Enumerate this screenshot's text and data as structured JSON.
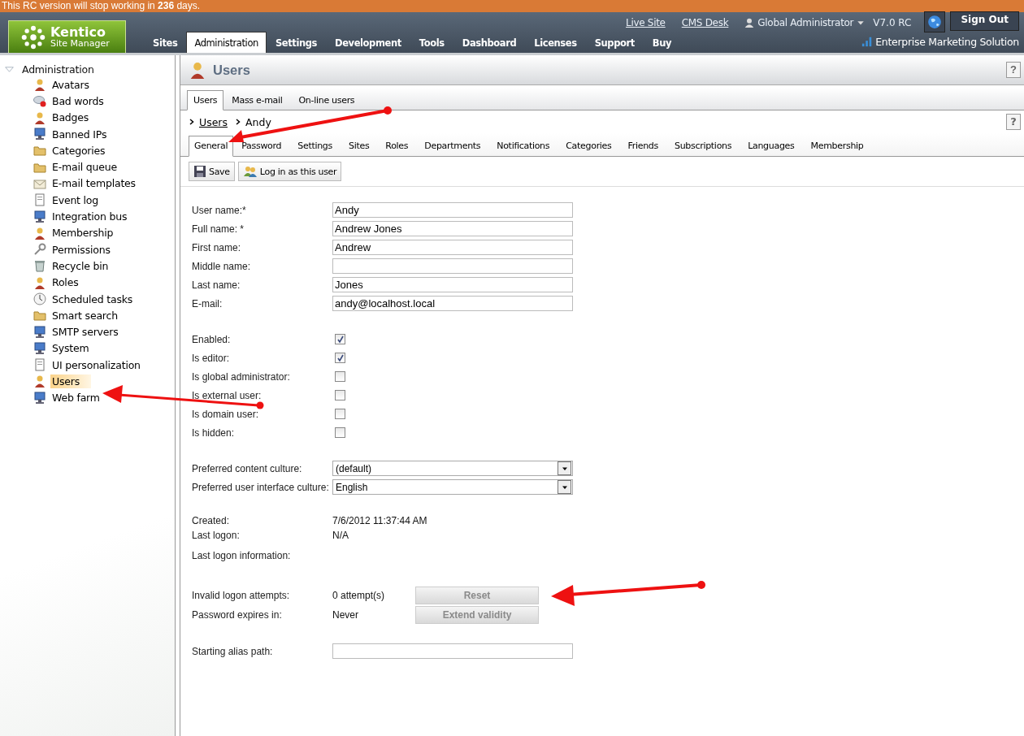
{
  "banner": {
    "text": "This RC version will stop working in **236** days."
  },
  "header": {
    "logo": {
      "title": "Kentico",
      "subtitle": "Site Manager"
    },
    "nav_tabs": [
      {
        "label": "Sites",
        "selected": false
      },
      {
        "label": "Administration",
        "selected": true
      },
      {
        "label": "Settings",
        "selected": false
      },
      {
        "label": "Development",
        "selected": false
      },
      {
        "label": "Tools",
        "selected": false
      },
      {
        "label": "Dashboard",
        "selected": false
      },
      {
        "label": "Licenses",
        "selected": false
      },
      {
        "label": "Support",
        "selected": false
      },
      {
        "label": "Buy",
        "selected": false
      }
    ],
    "links": [
      "Live Site",
      "CMS Desk"
    ],
    "user": "Global Administrator",
    "version": "V7.0 RC",
    "sign_out": "Sign Out",
    "edition": "Enterprise Marketing Solution"
  },
  "sidebar": {
    "root": {
      "label": "Administration",
      "expanded": true,
      "children": [
        {
          "label": "Avatars",
          "selected": false
        },
        {
          "label": "Bad words",
          "selected": false
        },
        {
          "label": "Badges",
          "selected": false
        },
        {
          "label": "Banned IPs",
          "selected": false
        },
        {
          "label": "Categories",
          "selected": false
        },
        {
          "label": "E-mail queue",
          "selected": false
        },
        {
          "label": "E-mail templates",
          "selected": false
        },
        {
          "label": "Event log",
          "selected": false
        },
        {
          "label": "Integration bus",
          "selected": false
        },
        {
          "label": "Membership",
          "selected": false
        },
        {
          "label": "Permissions",
          "selected": false
        },
        {
          "label": "Recycle bin",
          "selected": false
        },
        {
          "label": "Roles",
          "selected": false
        },
        {
          "label": "Scheduled tasks",
          "selected": false
        },
        {
          "label": "Smart search",
          "selected": false
        },
        {
          "label": "SMTP servers",
          "selected": false
        },
        {
          "label": "System",
          "selected": false
        },
        {
          "label": "UI personalization",
          "selected": false
        },
        {
          "label": "Users",
          "selected": true
        },
        {
          "label": "Web farm",
          "selected": false
        }
      ]
    }
  },
  "page": {
    "title": "Users",
    "title_help": "?",
    "breadcrumb_help": "?",
    "tabs": [
      {
        "label": "Users",
        "selected": true
      },
      {
        "label": "Mass e-mail",
        "selected": false
      },
      {
        "label": "On-line users",
        "selected": false
      }
    ],
    "breadcrumb": [
      {
        "label": "Users",
        "link": true
      },
      {
        "label": "Andy",
        "link": false
      }
    ],
    "user_tabs": [
      {
        "label": "General",
        "selected": true
      },
      {
        "label": "Password",
        "selected": false
      },
      {
        "label": "Settings",
        "selected": false
      },
      {
        "label": "Sites",
        "selected": false
      },
      {
        "label": "Roles",
        "selected": false
      },
      {
        "label": "Departments",
        "selected": false
      },
      {
        "label": "Notifications",
        "selected": false
      },
      {
        "label": "Categories",
        "selected": false
      },
      {
        "label": "Friends",
        "selected": false
      },
      {
        "label": "Subscriptions",
        "selected": false
      },
      {
        "label": "Languages",
        "selected": false
      },
      {
        "label": "Membership",
        "selected": false
      }
    ],
    "toolbar": [
      "Save",
      "Log in as this user"
    ],
    "form_groups": [
      [
        {
          "kind": "text",
          "label": "User name:*",
          "value": "Andy"
        },
        {
          "kind": "text",
          "label": "Full name: *",
          "value": "Andrew Jones"
        },
        {
          "kind": "text",
          "label": "First name:",
          "value": "Andrew"
        },
        {
          "kind": "text",
          "label": "Middle name:"
        },
        {
          "kind": "text",
          "label": "Last name:",
          "value": "Jones"
        },
        {
          "kind": "text",
          "label": "E-mail:",
          "value": "andy@localhost.local"
        }
      ],
      [
        {
          "kind": "checkbox",
          "label": "Enabled:",
          "checked": true
        },
        {
          "kind": "checkbox",
          "label": "Is editor:",
          "checked": true
        },
        {
          "kind": "checkbox",
          "label": "Is global administrator:",
          "checked": false
        },
        {
          "kind": "checkbox",
          "label": "Is external user:",
          "checked": false
        },
        {
          "kind": "checkbox",
          "label": "Is domain user:",
          "checked": false
        },
        {
          "kind": "checkbox",
          "label": "Is hidden:",
          "checked": false
        }
      ],
      [
        {
          "kind": "select",
          "label": "Preferred content culture:",
          "value": "(default)"
        },
        {
          "kind": "select",
          "label": "Preferred user interface culture:",
          "value": "English"
        }
      ],
      [
        {
          "kind": "info",
          "label": "Created:",
          "value": "7/6/2012 11:37:44 AM"
        },
        {
          "kind": "info",
          "label": "Last logon:",
          "value": "N/A"
        },
        {
          "kind": "info",
          "label": "Last logon information:"
        }
      ],
      [
        {
          "kind": "action",
          "label": "Invalid logon attempts:",
          "value": "0 attempt(s)",
          "button": "Reset",
          "disabled": true
        },
        {
          "kind": "action",
          "label": "Password expires in:",
          "value": "Never",
          "button": "Extend validity",
          "disabled": true
        }
      ],
      [
        {
          "kind": "text",
          "label": "Starting alias path:"
        }
      ]
    ]
  }
}
